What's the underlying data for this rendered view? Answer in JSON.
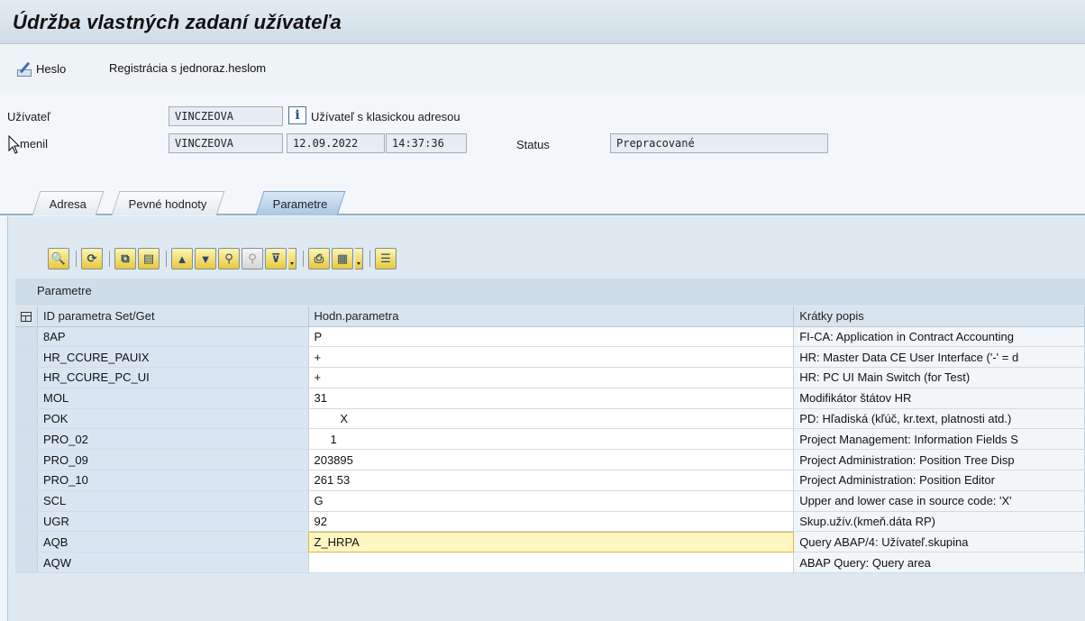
{
  "window": {
    "title": "Údržba vlastných zadaní užívateľa"
  },
  "toolbar": {
    "password_label": "Heslo",
    "one_time_label": "Registrácia s jednoraz.heslom"
  },
  "header": {
    "user_label": "Užívateľ",
    "user_value": "VINCZEOVA",
    "user_type": "Užívateľ s klasickou adresou",
    "changed_label": "menil",
    "changed_by": "VINCZEOVA",
    "changed_date": "12.09.2022",
    "changed_time": "14:37:36",
    "status_label": "Status",
    "status_value": "Prepracované"
  },
  "tabs": [
    {
      "label": "Adresa",
      "active": false
    },
    {
      "label": "Pevné hodnoty",
      "active": false
    },
    {
      "label": "Parametre",
      "active": true
    }
  ],
  "grid": {
    "title": "Parametre",
    "columns": [
      "ID parametra Set/Get",
      "Hodn.parametra",
      "Krátky popis"
    ],
    "rows": [
      {
        "id": "8AP",
        "value": "P",
        "desc": "FI-CA: Application in Contract Accounting"
      },
      {
        "id": "HR_CCURE_PAUIX",
        "value": "+",
        "desc": "HR: Master Data CE User Interface ('-' = d"
      },
      {
        "id": "HR_CCURE_PC_UI",
        "value": "+",
        "desc": "HR: PC UI Main Switch (for Test)"
      },
      {
        "id": "MOL",
        "value": "31",
        "desc": "Modifikátor štátov HR"
      },
      {
        "id": "POK",
        "value": "        X",
        "desc": "PD: Hľadiská (kľúč, kr.text, platnosti atd.)"
      },
      {
        "id": "PRO_02",
        "value": "     1",
        "desc": "Project Management: Information Fields S"
      },
      {
        "id": "PRO_09",
        "value": "203895",
        "desc": "Project Administration: Position Tree Disp"
      },
      {
        "id": "PRO_10",
        "value": "261 53",
        "desc": "Project Administration: Position Editor"
      },
      {
        "id": "SCL",
        "value": "G",
        "desc": "Upper and lower case in source code: 'X'"
      },
      {
        "id": "UGR",
        "value": "92",
        "desc": "Skup.užív.(kmeň.dáta RP)"
      },
      {
        "id": "AQB",
        "value": "Z_HRPA",
        "desc": "Query ABAP/4: Užívateľ.skupina"
      },
      {
        "id": "AQW",
        "value": "",
        "desc": "ABAP Query: Query area"
      }
    ]
  },
  "colors": {
    "title_bar": "#cfdce6",
    "active_cell": "#fff7c2",
    "active_tab": "#a9c6e3"
  }
}
